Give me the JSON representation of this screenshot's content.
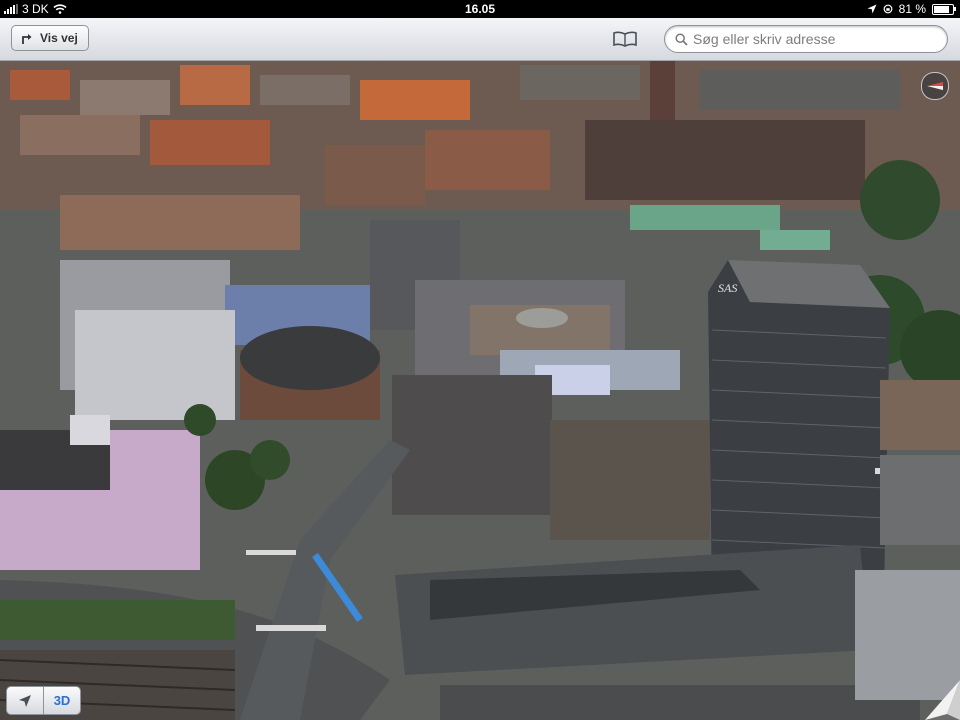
{
  "status_bar": {
    "carrier": "3 DK",
    "time": "16.05",
    "battery_percent": "81 %",
    "battery_level": 0.81
  },
  "toolbar": {
    "directions_label": "Vis vej",
    "search_placeholder": "Søg eller skriv adresse"
  },
  "map": {
    "view_mode_label": "3D",
    "building_sign": "SAS"
  },
  "colors": {
    "accent": "#2a6fd6",
    "toolbar_top": "#f4f5f7",
    "toolbar_bottom": "#d6d9df"
  },
  "icons": {
    "directions": "turn-arrow-icon",
    "bookmarks": "open-book-icon",
    "search": "magnifier-icon",
    "compass": "compass-icon",
    "location": "location-arrow-icon"
  }
}
